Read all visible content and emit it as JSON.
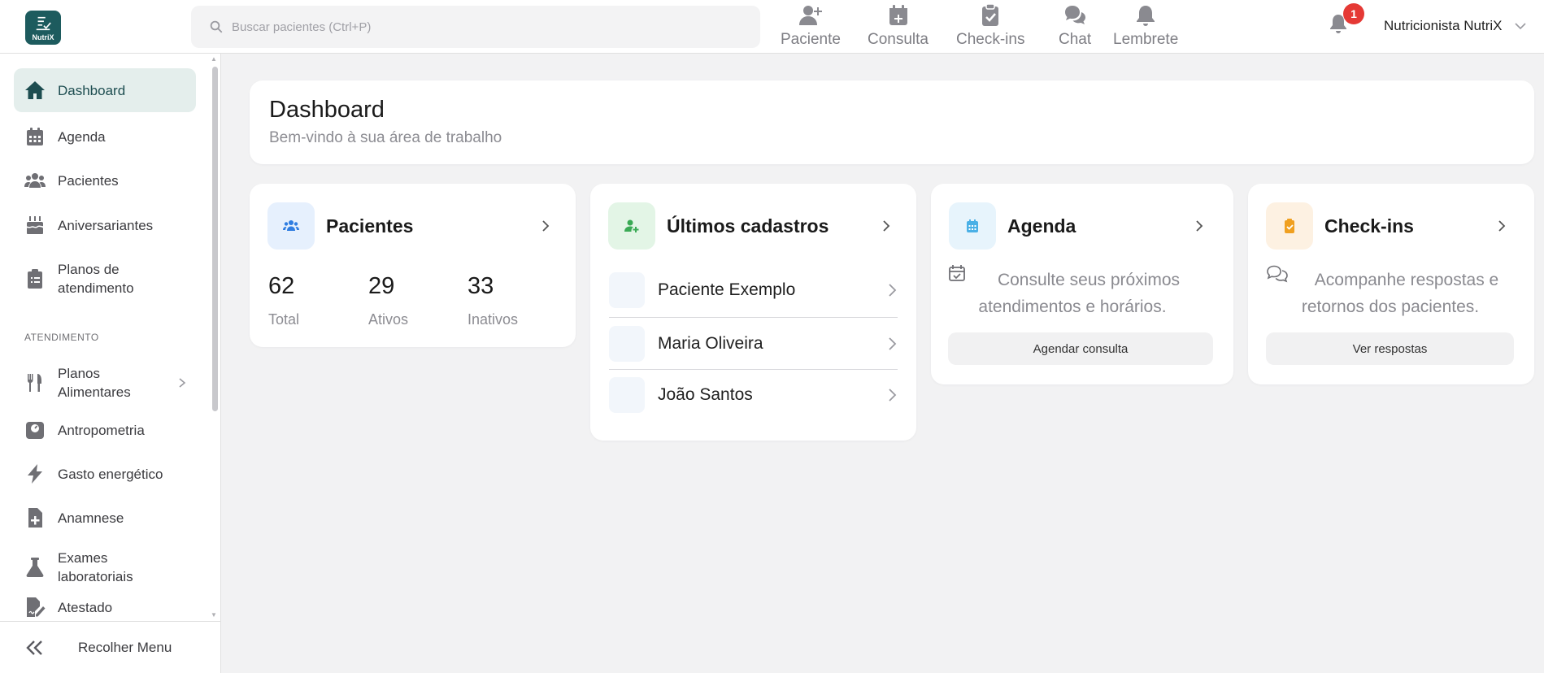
{
  "app": {
    "logo_text": "NutriX"
  },
  "search": {
    "placeholder": "Buscar pacientes (Ctrl+P)"
  },
  "quick_actions": [
    {
      "label": "Paciente",
      "icon": "user-plus-icon"
    },
    {
      "label": "Consulta",
      "icon": "calendar-plus-icon"
    },
    {
      "label": "Check-ins",
      "icon": "clipboard-check-icon"
    },
    {
      "label": "Chat",
      "icon": "chat-bubbles-icon"
    },
    {
      "label": "Lembrete",
      "icon": "bell-icon"
    }
  ],
  "notifications": {
    "count": "1"
  },
  "user": {
    "name": "Nutricionista NutriX"
  },
  "sidebar": {
    "items": [
      {
        "label": "Dashboard",
        "icon": "home-icon"
      },
      {
        "label": "Agenda",
        "icon": "calendar-icon"
      },
      {
        "label": "Pacientes",
        "icon": "users-icon"
      },
      {
        "label": "Aniversariantes",
        "icon": "birthday-cake-icon"
      },
      {
        "label": "Planos de atendimento",
        "icon": "clipboard-list-icon"
      }
    ],
    "section_label": "ATENDIMENTO",
    "section_items": [
      {
        "label": "Planos Alimentares",
        "icon": "fork-knife-icon"
      },
      {
        "label": "Antropometria",
        "icon": "scale-icon"
      },
      {
        "label": "Gasto energético",
        "icon": "bolt-icon"
      },
      {
        "label": "Anamnese",
        "icon": "file-plus-icon"
      },
      {
        "label": "Exames laboratoriais",
        "icon": "flask-icon"
      },
      {
        "label": "Atestado",
        "icon": "file-signature-icon"
      }
    ],
    "collapse_label": "Recolher Menu"
  },
  "header": {
    "title": "Dashboard",
    "subtitle": "Bem-vindo à sua área de trabalho"
  },
  "cards": {
    "pacientes": {
      "title": "Pacientes",
      "stats": [
        {
          "value": "62",
          "label": "Total"
        },
        {
          "value": "29",
          "label": "Ativos"
        },
        {
          "value": "33",
          "label": "Inativos"
        }
      ]
    },
    "ultimos": {
      "title": "Últimos cadastros",
      "items": [
        "Paciente Exemplo",
        "Maria Oliveira",
        "João Santos"
      ]
    },
    "agenda": {
      "title": "Agenda",
      "description_line1": "Consulte seus próximos",
      "description_line2": "atendimentos e horários.",
      "button": "Agendar consulta"
    },
    "checkins": {
      "title": "Check-ins",
      "description_line1": "Acompanhe respostas e",
      "description_line2": "retornos dos pacientes.",
      "button": "Ver respostas"
    }
  },
  "colors": {
    "brand": "#1d5b5e",
    "active_bg": "#e4eeec",
    "badge": "#e53935",
    "pacientes_tile": "#e6f0fd",
    "ultimos_tile": "#e3f5e6",
    "agenda_tile": "#e7f4fc",
    "checkins_tile": "#fdf1e2"
  }
}
